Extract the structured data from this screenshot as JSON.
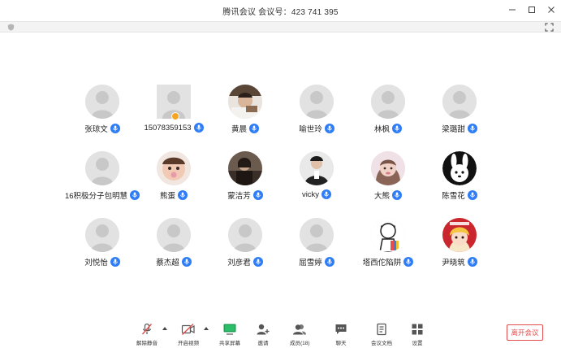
{
  "window": {
    "title": "腾讯会议 会议号：423 741 395"
  },
  "participants": [
    {
      "name": "张琼文",
      "avatar": "default",
      "mic": "on"
    },
    {
      "name": "15078359153",
      "avatar": "default",
      "mic": "on",
      "host": true
    },
    {
      "name": "黄晨",
      "avatar": "photo-man",
      "mic": "on"
    },
    {
      "name": "喻世玲",
      "avatar": "default",
      "mic": "on"
    },
    {
      "name": "林枫",
      "avatar": "default",
      "mic": "on"
    },
    {
      "name": "梁璐甜",
      "avatar": "default",
      "mic": "on"
    },
    {
      "name": "16积极分子包明慧",
      "avatar": "default",
      "mic": "on"
    },
    {
      "name": "熊蛋",
      "avatar": "photo-baby",
      "mic": "on"
    },
    {
      "name": "蒙洁芳",
      "avatar": "photo-dark",
      "mic": "on"
    },
    {
      "name": "vicky",
      "avatar": "photo-person",
      "mic": "on"
    },
    {
      "name": "大熊",
      "avatar": "photo-girl",
      "mic": "on"
    },
    {
      "name": "陈雪花",
      "avatar": "cartoon-bunny",
      "mic": "on"
    },
    {
      "name": "刘悦怡",
      "avatar": "default",
      "mic": "on"
    },
    {
      "name": "蔡杰超",
      "avatar": "default",
      "mic": "on"
    },
    {
      "name": "刘彦君",
      "avatar": "default",
      "mic": "on"
    },
    {
      "name": "屈雪婷",
      "avatar": "default",
      "mic": "on"
    },
    {
      "name": "塔西佗陷阱",
      "avatar": "cartoon-boy",
      "mic": "on"
    },
    {
      "name": "尹晓筑",
      "avatar": "cartoon-red",
      "mic": "on"
    }
  ],
  "toolbar": {
    "unmute": "解除静音",
    "start_video": "开启视频",
    "share_screen": "共享屏幕",
    "invite": "邀请",
    "members": "成员(18)",
    "chat": "聊天",
    "docs": "会议文档",
    "settings": "设置"
  },
  "leave_button": "离开会议",
  "colors": {
    "accent": "#2f7df6",
    "danger": "#e24c4c",
    "host_badge": "#f5a623"
  }
}
